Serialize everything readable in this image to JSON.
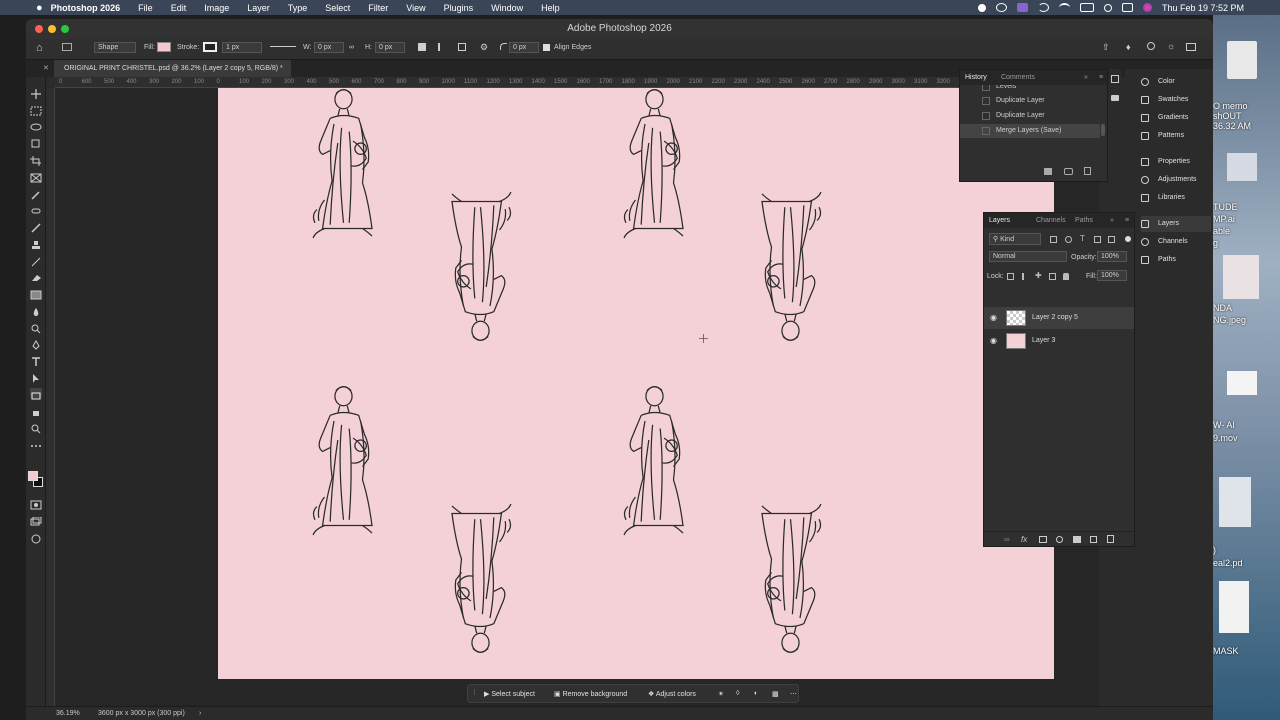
{
  "menubar": {
    "apple": "",
    "app": "Photoshop 2026",
    "items": [
      "File",
      "Edit",
      "Image",
      "Layer",
      "Type",
      "Select",
      "Filter",
      "View",
      "Plugins",
      "Window",
      "Help"
    ],
    "clock": "Thu Feb 19  7:52 PM"
  },
  "window": {
    "title": "Adobe Photoshop 2026"
  },
  "options": {
    "mode": "Shape",
    "fill_label": "Fill:",
    "stroke_label": "Stroke:",
    "stroke_width": "1 px",
    "w_label": "W:",
    "w_value": "0 px",
    "h_label": "H:",
    "h_value": "0 px",
    "radius_value": "0 px",
    "align_edges": "Align Edges",
    "fill_color": "#f3c8cf"
  },
  "document": {
    "tab_title": "ORIGINAL PRINT CHRISTEL.psd @ 36.2% (Layer 2 copy 5, RGB/8) *",
    "canvas_color": "#f3d1d7"
  },
  "ruler": [
    "0",
    "600",
    "500",
    "400",
    "300",
    "200",
    "100",
    "0",
    "100",
    "200",
    "300",
    "400",
    "500",
    "600",
    "700",
    "800",
    "900",
    "1000",
    "1100",
    "1200",
    "1300",
    "1400",
    "1500",
    "1600",
    "1700",
    "1800",
    "1900",
    "2000",
    "2100",
    "2200",
    "2300",
    "2400",
    "2500",
    "2600",
    "2700",
    "2800",
    "2900",
    "3000",
    "3100",
    "3200",
    "3300"
  ],
  "history": {
    "tabs": [
      "History",
      "Comments"
    ],
    "items": [
      "Levels",
      "Duplicate Layer",
      "Duplicate Layer",
      "Merge Layers (Save)"
    ]
  },
  "dock": {
    "group1": [
      "Color",
      "Swatches",
      "Gradients",
      "Patterns"
    ],
    "group2": [
      "Properties",
      "Adjustments",
      "Libraries"
    ],
    "group3": [
      "Layers",
      "Channels",
      "Paths"
    ]
  },
  "layers": {
    "tabs": [
      "Layers",
      "Channels",
      "Paths"
    ],
    "kind": "Kind",
    "blend": "Normal",
    "opacity_label": "Opacity:",
    "opacity": "100%",
    "lock_label": "Lock:",
    "fill_label": "Fill:",
    "fill": "100%",
    "items": [
      {
        "name": "Layer 2 copy 5",
        "selected": true
      },
      {
        "name": "Layer 3",
        "selected": false
      }
    ]
  },
  "context_bar": {
    "select_subject": "Select subject",
    "remove_background": "Remove background",
    "adjust_colors": "Adjust colors"
  },
  "status": {
    "zoom": "36.19%",
    "doc_size": "3600 px x 3000 px (300 ppi)"
  },
  "desktop": {
    "labels": [
      "O memo",
      "shOUT",
      "36.32 AM",
      "TUDE",
      "MP.ai",
      "able",
      "g",
      "NDA",
      "NG.jpeg",
      "W- AI",
      "9.mov",
      ")",
      "eal2.pd",
      "MASK"
    ]
  }
}
